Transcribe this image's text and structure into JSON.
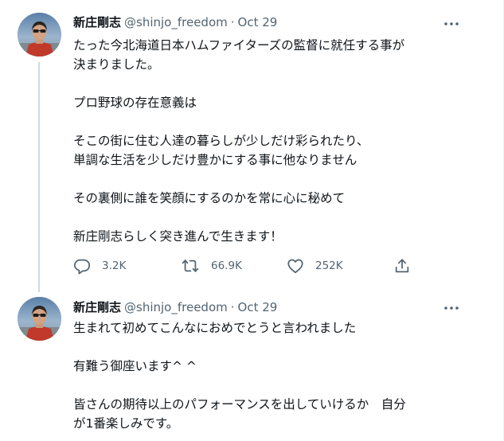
{
  "tweets": [
    {
      "author_name": "新庄剛志",
      "handle": "@shinjo_freedom",
      "separator": "·",
      "date": "Oct 29",
      "text_lines": [
        "たった今北海道日本ハムファイターズの監督に就任する事が",
        "決まりました。",
        "",
        "プロ野球の存在意義は",
        "",
        "そこの街に住む人達の暮らしが少しだけ彩られたり、",
        "単調な生活を少しだけ豊かにする事に他なりません",
        "",
        "その裏側に誰を笑顔にするのかを常に心に秘めて",
        "",
        "新庄剛志らしく突き進んで生きます！"
      ],
      "reply_count": "3.2K",
      "retweet_count": "66.9K",
      "like_count": "252K"
    },
    {
      "author_name": "新庄剛志",
      "handle": "@shinjo_freedom",
      "separator": "·",
      "date": "Oct 29",
      "text_lines": [
        "生まれて初めてこんなにおめでとうと言われました",
        "",
        "有難う御座います^ ^",
        "",
        "皆さんの期待以上のパフォーマンスを出していけるか　自分",
        "が1番楽しみです。"
      ]
    }
  ],
  "icons": {
    "more": "more-horizontal-icon",
    "reply": "reply-icon",
    "retweet": "retweet-icon",
    "like": "heart-icon",
    "share": "share-icon"
  },
  "colors": {
    "text": "#0f1419",
    "secondary": "#536471",
    "thread_line": "#cfd9de",
    "border": "#eff3f4"
  }
}
